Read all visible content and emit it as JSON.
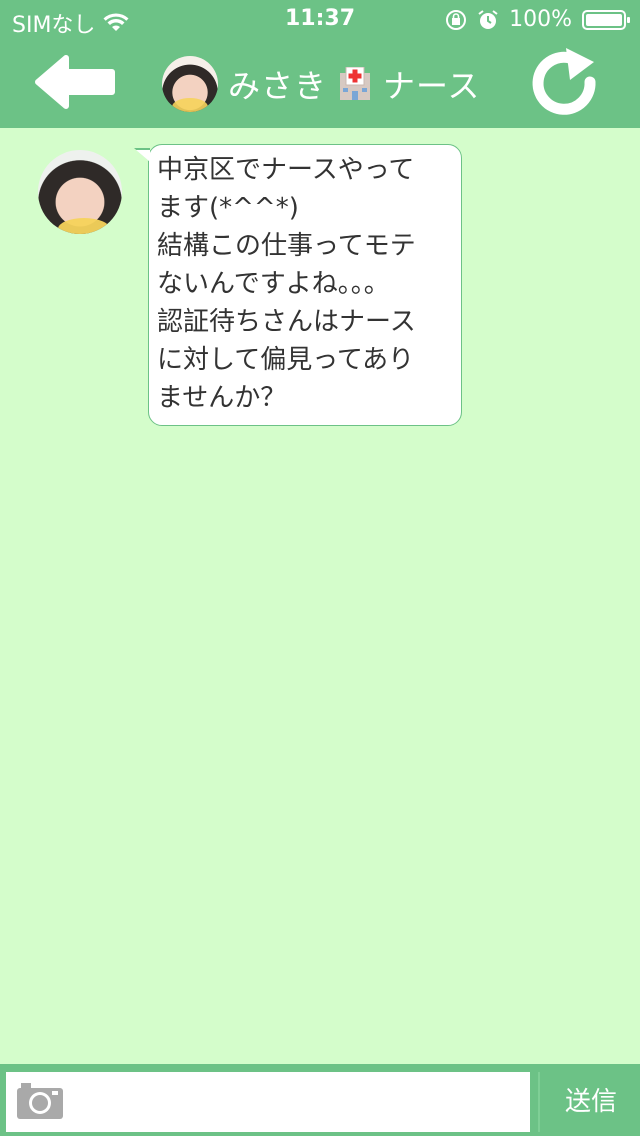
{
  "status_bar": {
    "carrier": "SIMなし",
    "time": "11:37",
    "battery_percent": "100%",
    "icons": [
      "wifi-icon",
      "rotation-lock-icon",
      "alarm-icon",
      "battery-icon"
    ]
  },
  "header": {
    "back_icon": "arrow-left-icon",
    "title_name": "みさき",
    "title_emoji": "hospital-icon",
    "title_role": "ナース",
    "refresh_icon": "refresh-icon"
  },
  "messages": [
    {
      "sender_avatar": "avatar",
      "text": "中京区でナースやって\nます(*^^*)\n結構この仕事ってモテ\nないんですよね。。。\n認証待ちさんはナース\nに対して偏見ってあり\nませんか？"
    }
  ],
  "composer": {
    "camera_icon": "camera-icon",
    "input_value": "",
    "send_label": "送信"
  },
  "colors": {
    "header": "#6cc286",
    "background": "#d4fdcb",
    "bubble_border": "#6cc286"
  }
}
